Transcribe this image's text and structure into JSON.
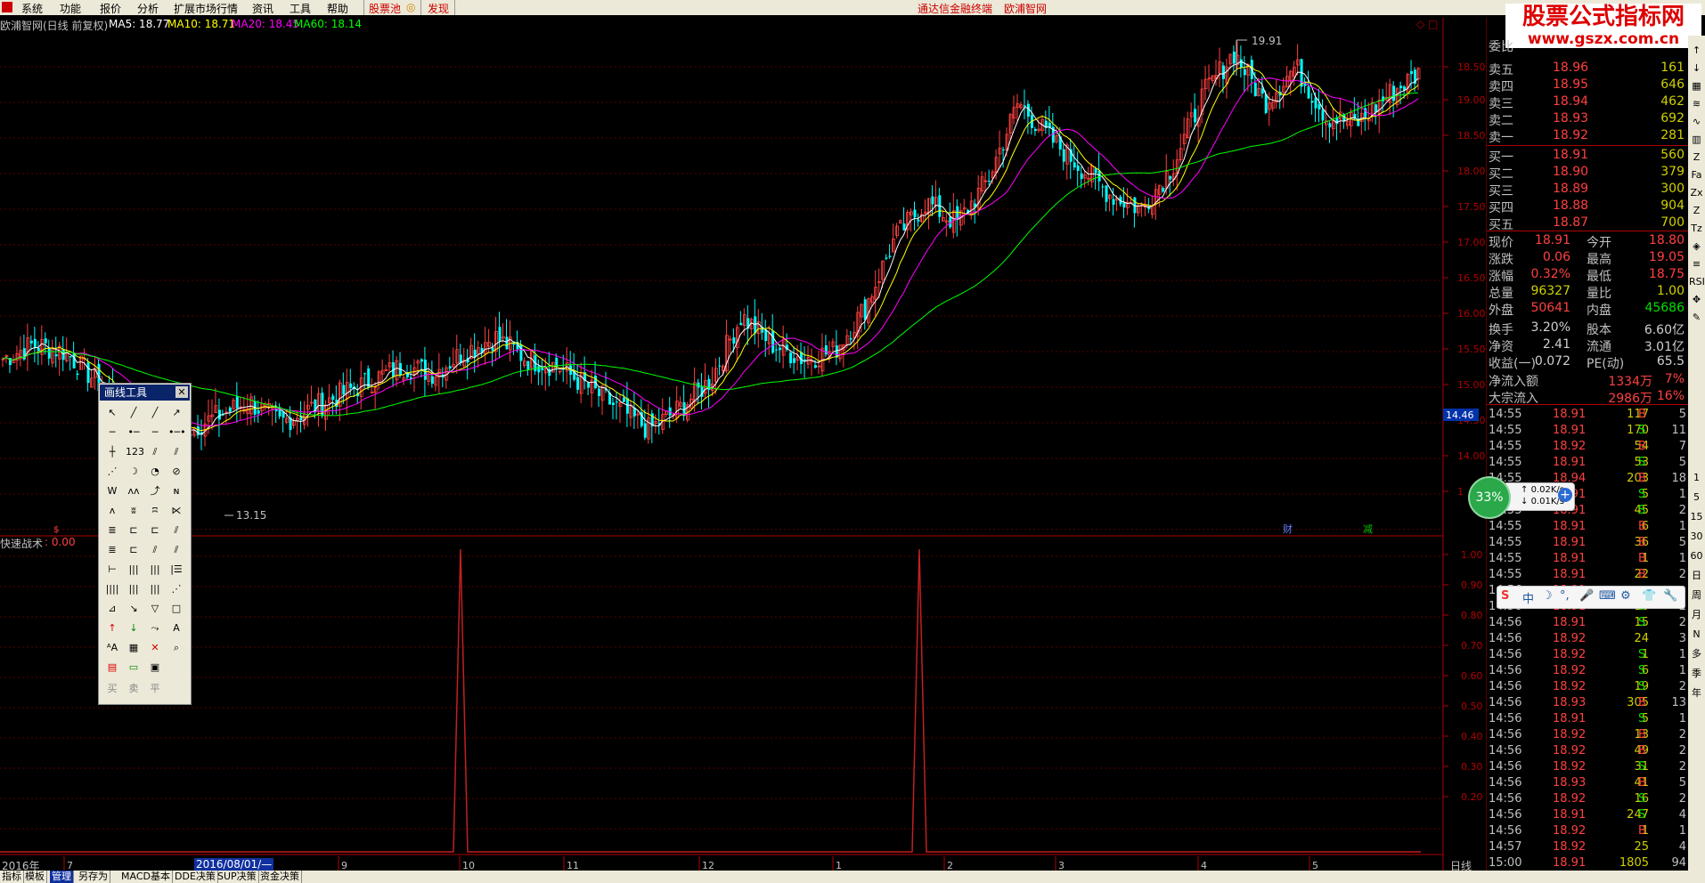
{
  "menubar": {
    "items": [
      "系统",
      "功能",
      "报价",
      "分析",
      "扩展市场行情",
      "资讯",
      "工具",
      "帮助"
    ],
    "stockpool": "股票池",
    "discover": "发现",
    "center_title": "通达信金融终端",
    "center_site": "欧浦智网"
  },
  "watermark": {
    "line1": "股票公式指标网",
    "line2": "www.gszx.com.cn"
  },
  "main_chart": {
    "stock": "欧浦智网(日线 前复权)",
    "ma5": "MA5: 18.77",
    "ma10": "MA10: 18.71",
    "ma20": "MA20: 18.45",
    "ma60": "MA60: 18.14",
    "high_label": "19.91",
    "low_label": "13.15",
    "price_tag": "14.46",
    "marker_cai": "财",
    "marker_jian": "减",
    "y_ticks": [
      "18.50",
      "19.00",
      "18.50",
      "18.00",
      "17.50",
      "17.00",
      "16.50",
      "16.00",
      "15.50",
      "15.00",
      "14.50",
      "14.00",
      "1"
    ]
  },
  "sub_chart": {
    "name": "快速战术",
    "value": ": 0.00",
    "y_ticks": [
      "1.00",
      "0.90",
      "0.80",
      "0.70",
      "0.60",
      "0.50",
      "0.40",
      "0.30",
      "0.20"
    ]
  },
  "x_axis": {
    "year": "2016年",
    "ticks": [
      "7",
      "9",
      "10",
      "11",
      "12",
      "1",
      "2",
      "3",
      "4",
      "5"
    ],
    "cursor_date": "2016/08/01/—",
    "period": "日线"
  },
  "chart_data": {
    "type": "candlestick",
    "title": "欧浦智网(日线 前复权)",
    "period": "日线",
    "y_range": [
      13.0,
      20.0
    ],
    "indicators": {
      "MA5": 18.77,
      "MA10": 18.71,
      "MA20": 18.45,
      "MA60": 18.14
    },
    "annotations": [
      {
        "label": "19.91",
        "type": "high"
      },
      {
        "label": "13.15",
        "type": "low"
      }
    ],
    "price_closes": [
      14.9,
      15.1,
      15.0,
      14.6,
      14.2,
      14.0,
      13.9,
      14.1,
      14.3,
      14.0,
      14.2,
      14.4,
      14.6,
      14.8,
      14.7,
      15.0,
      15.2,
      14.9,
      14.8,
      14.5,
      14.2,
      13.9,
      14.2,
      14.6,
      15.5,
      15.1,
      14.9,
      15.0,
      15.6,
      16.6,
      17.1,
      16.8,
      17.4,
      18.5,
      18.0,
      17.6,
      17.2,
      17.0,
      17.6,
      18.6,
      19.2,
      18.5,
      19.0,
      18.3,
      18.2,
      18.6,
      18.9
    ],
    "sub_indicator": {
      "name": "快速战术",
      "value": 0.0,
      "y_range": [
        0,
        1.0
      ],
      "spikes": [
        1.0,
        1.0
      ]
    }
  },
  "quote": {
    "top_label": "委比",
    "asks": [
      {
        "label": "卖五",
        "price": "18.96",
        "vol": "161"
      },
      {
        "label": "卖四",
        "price": "18.95",
        "vol": "646"
      },
      {
        "label": "卖三",
        "price": "18.94",
        "vol": "462"
      },
      {
        "label": "卖二",
        "price": "18.93",
        "vol": "692"
      },
      {
        "label": "卖一",
        "price": "18.92",
        "vol": "281"
      }
    ],
    "bids": [
      {
        "label": "买一",
        "price": "18.91",
        "vol": "560"
      },
      {
        "label": "买二",
        "price": "18.90",
        "vol": "379"
      },
      {
        "label": "买三",
        "price": "18.89",
        "vol": "300"
      },
      {
        "label": "买四",
        "price": "18.88",
        "vol": "904"
      },
      {
        "label": "买五",
        "price": "18.87",
        "vol": "700"
      }
    ],
    "stats": [
      {
        "l1": "现价",
        "v1": "18.91",
        "l2": "今开",
        "v2": "18.80",
        "c1": "#ff4040",
        "c2": "#ff4040"
      },
      {
        "l1": "涨跌",
        "v1": "0.06",
        "l2": "最高",
        "v2": "19.05",
        "c1": "#ff4040",
        "c2": "#ff4040"
      },
      {
        "l1": "涨幅",
        "v1": "0.32%",
        "l2": "最低",
        "v2": "18.75",
        "c1": "#ff4040",
        "c2": "#ff4040"
      },
      {
        "l1": "总量",
        "v1": "96327",
        "l2": "量比",
        "v2": "1.00",
        "c1": "#d0d000",
        "c2": "#d0d000"
      },
      {
        "l1": "外盘",
        "v1": "50641",
        "l2": "内盘",
        "v2": "45686",
        "c1": "#ff4040",
        "c2": "#00e000"
      },
      {
        "l1": "换手",
        "v1": "3.20%",
        "l2": "股本",
        "v2": "6.60亿",
        "c1": "#d0d0d0",
        "c2": "#d0d0d0"
      },
      {
        "l1": "净资",
        "v1": "2.41",
        "l2": "流通",
        "v2": "3.01亿",
        "c1": "#d0d0d0",
        "c2": "#d0d0d0"
      },
      {
        "l1": "收益(一)",
        "v1": "0.072",
        "l2": "PE(动)",
        "v2": "65.5",
        "c1": "#d0d0d0",
        "c2": "#d0d0d0"
      }
    ],
    "flow": [
      {
        "label": "净流入额",
        "value": "1334万",
        "pct": "7%"
      },
      {
        "label": "大宗流入",
        "value": "2986万",
        "pct": "16%"
      }
    ],
    "trades": [
      {
        "t": "14:55",
        "p": "18.91",
        "v": "117",
        "s": "B",
        "n": "5"
      },
      {
        "t": "14:55",
        "p": "18.91",
        "v": "170",
        "s": "S",
        "n": "11"
      },
      {
        "t": "14:55",
        "p": "18.92",
        "v": "54",
        "s": "B",
        "n": "7"
      },
      {
        "t": "14:55",
        "p": "18.91",
        "v": "53",
        "s": "S",
        "n": "5"
      },
      {
        "t": "14:55",
        "p": "18.94",
        "v": "203",
        "s": "B",
        "n": "18"
      },
      {
        "t": "14:55",
        "p": "18.91",
        "v": "5",
        "s": "S",
        "n": "1"
      },
      {
        "t": "14:55",
        "p": "18.91",
        "v": "45",
        "s": "S",
        "n": "2"
      },
      {
        "t": "14:55",
        "p": "18.91",
        "v": "6",
        "s": "B",
        "n": "1"
      },
      {
        "t": "14:55",
        "p": "18.91",
        "v": "36",
        "s": "B",
        "n": "5"
      },
      {
        "t": "14:55",
        "p": "18.91",
        "v": "1",
        "s": "B",
        "n": "1"
      },
      {
        "t": "14:55",
        "p": "18.91",
        "v": "22",
        "s": "B",
        "n": "2"
      },
      {
        "t": "14:56",
        "p": "18.91",
        "v": "",
        "s": "",
        "n": ""
      },
      {
        "t": "14:56",
        "p": "18.91",
        "v": "10",
        "s": "S",
        "n": "2"
      },
      {
        "t": "14:56",
        "p": "18.91",
        "v": "15",
        "s": "S",
        "n": "2"
      },
      {
        "t": "14:56",
        "p": "18.92",
        "v": "24",
        "s": "",
        "n": "3"
      },
      {
        "t": "14:56",
        "p": "18.92",
        "v": "1",
        "s": "S",
        "n": "1"
      },
      {
        "t": "14:56",
        "p": "18.92",
        "v": "6",
        "s": "S",
        "n": "1"
      },
      {
        "t": "14:56",
        "p": "18.92",
        "v": "19",
        "s": "S",
        "n": "2"
      },
      {
        "t": "14:56",
        "p": "18.93",
        "v": "305",
        "s": "B",
        "n": "13"
      },
      {
        "t": "14:56",
        "p": "18.91",
        "v": "5",
        "s": "S",
        "n": "1"
      },
      {
        "t": "14:56",
        "p": "18.92",
        "v": "13",
        "s": "B",
        "n": "2"
      },
      {
        "t": "14:56",
        "p": "18.92",
        "v": "49",
        "s": "B",
        "n": "2"
      },
      {
        "t": "14:56",
        "p": "18.92",
        "v": "31",
        "s": "S",
        "n": "2"
      },
      {
        "t": "14:56",
        "p": "18.93",
        "v": "41",
        "s": "B",
        "n": "5"
      },
      {
        "t": "14:56",
        "p": "18.92",
        "v": "16",
        "s": "S",
        "n": "2"
      },
      {
        "t": "14:56",
        "p": "18.91",
        "v": "247",
        "s": "S",
        "n": "4"
      },
      {
        "t": "14:56",
        "p": "18.92",
        "v": "1",
        "s": "B",
        "n": "1"
      },
      {
        "t": "14:57",
        "p": "18.92",
        "v": "25",
        "s": "",
        "n": "4"
      },
      {
        "t": "15:00",
        "p": "18.91",
        "v": "1805",
        "s": "",
        "n": "94"
      }
    ]
  },
  "right_toolbar": {
    "labels": [
      "1",
      "5",
      "15",
      "30",
      "60",
      "日",
      "周",
      "月",
      "N",
      "多",
      "季",
      "年"
    ]
  },
  "net_widget": {
    "percent": "33%",
    "up": "0.02K/s",
    "down": "0.01K/s"
  },
  "ime": {
    "items": [
      "S",
      "中",
      "☽",
      "°,",
      "🎤",
      "⌨",
      "⚙",
      "👕",
      "🔧"
    ]
  },
  "draw_tool": {
    "title": "画线工具",
    "bottom": [
      "买",
      "卖",
      "平"
    ]
  },
  "bottom_tabs": [
    "指标",
    "模板",
    "管理",
    "另存为",
    "MACD基本",
    "DDE决策",
    "SUP决策",
    "资金决策"
  ],
  "colors": {
    "up": "#ff4040",
    "down": "#00ffff",
    "ma5": "#ffffff",
    "ma10": "#ffff00",
    "ma20": "#ff00ff",
    "ma60": "#00ff00",
    "grid": "#8b0000",
    "axis": "#b00000"
  }
}
